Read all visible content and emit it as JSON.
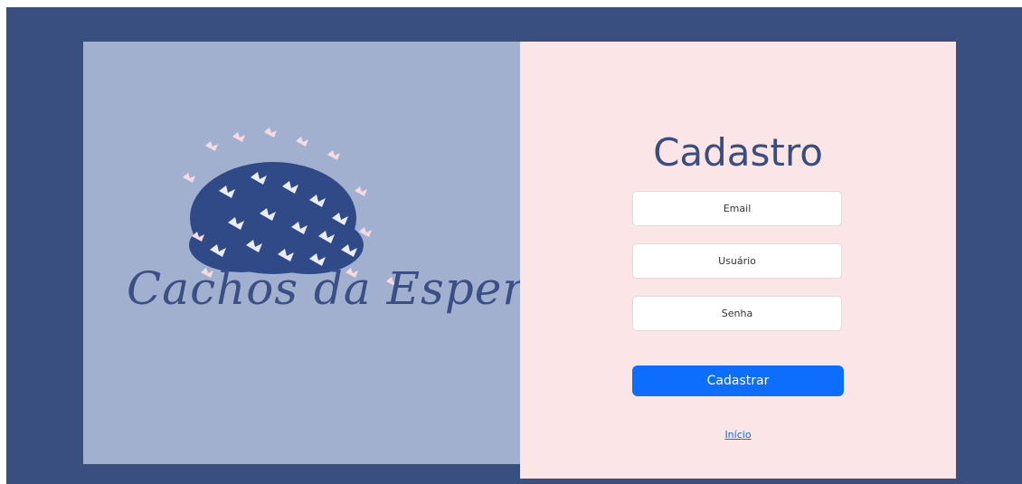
{
  "brand": {
    "logo_text": "Cachos da Esperança",
    "logo_icon": "butterfly-hair-icon"
  },
  "form": {
    "title": "Cadastro",
    "email_placeholder": "Email",
    "user_placeholder": "Usuário",
    "password_placeholder": "Senha",
    "submit_label": "Cadastrar",
    "home_link": "Início"
  },
  "colors": {
    "page_bg": "#384f80",
    "left_panel": "#a2b0cf",
    "right_panel": "#fce5e7",
    "primary": "#0d6efd",
    "title": "#3a4d7c"
  }
}
